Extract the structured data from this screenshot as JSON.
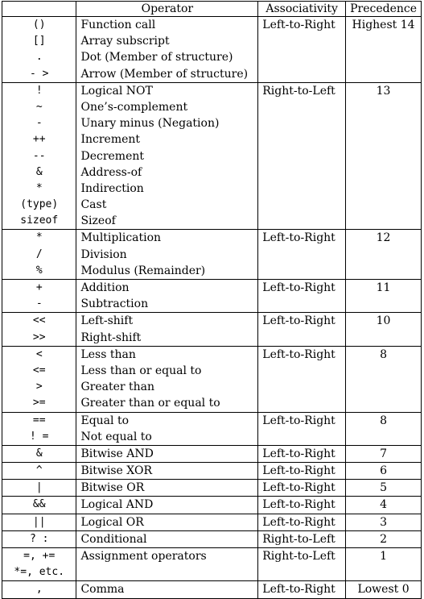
{
  "headers": [
    "",
    "Operator",
    "Associativity",
    "Precedence"
  ],
  "groups": [
    {
      "ops": [
        "()",
        "[]",
        ".",
        "- >"
      ],
      "descs": [
        "Function call",
        "Array subscript",
        "Dot (Member of structure)",
        "Arrow (Member of structure)"
      ],
      "assoc": "Left-to-Right",
      "prec": "Highest 14"
    },
    {
      "ops": [
        "!",
        "~",
        "-",
        "++",
        "--",
        "&",
        "*",
        "(type)",
        "sizeof"
      ],
      "descs": [
        "Logical NOT",
        "One’s-complement",
        "Unary minus (Negation)",
        "Increment",
        "Decrement",
        "Address-of",
        "Indirection",
        "Cast",
        "Sizeof"
      ],
      "assoc": "Right-to-Left",
      "prec": "13"
    },
    {
      "ops": [
        "*",
        "/",
        "%"
      ],
      "descs": [
        "Multiplication",
        "Division",
        "Modulus (Remainder)"
      ],
      "assoc": "Left-to-Right",
      "prec": "12"
    },
    {
      "ops": [
        "+",
        "-"
      ],
      "descs": [
        "Addition",
        "Subtraction"
      ],
      "assoc": "Left-to-Right",
      "prec": "11"
    },
    {
      "ops": [
        "<<",
        ">>"
      ],
      "descs": [
        "Left-shift",
        "Right-shift"
      ],
      "assoc": "Left-to-Right",
      "prec": "10"
    },
    {
      "ops": [
        "<",
        "<=",
        ">",
        ">="
      ],
      "descs": [
        "Less than",
        "Less than or equal to",
        "Greater than",
        "Greater than or equal to"
      ],
      "assoc": "Left-to-Right",
      "prec": "8"
    },
    {
      "ops": [
        "==",
        "! ="
      ],
      "descs": [
        "Equal to",
        "Not equal to"
      ],
      "assoc": "Left-to-Right",
      "prec": "8"
    },
    {
      "ops": [
        "&"
      ],
      "descs": [
        "Bitwise AND"
      ],
      "assoc": "Left-to-Right",
      "prec": "7"
    },
    {
      "ops": [
        "^"
      ],
      "descs": [
        "Bitwise XOR"
      ],
      "assoc": "Left-to-Right",
      "prec": "6"
    },
    {
      "ops": [
        "|"
      ],
      "descs": [
        "Bitwise OR"
      ],
      "assoc": "Left-to-Right",
      "prec": "5"
    },
    {
      "ops": [
        "&&"
      ],
      "descs": [
        "Logical AND"
      ],
      "assoc": "Left-to-Right",
      "prec": "4"
    },
    {
      "ops": [
        "||"
      ],
      "descs": [
        "Logical OR"
      ],
      "assoc": "Left-to-Right",
      "prec": "3"
    },
    {
      "ops": [
        "?  :"
      ],
      "descs": [
        "Conditional"
      ],
      "assoc": "Right-to-Left",
      "prec": "2"
    },
    {
      "ops": [
        "=, +=",
        "*=, etc."
      ],
      "descs": [
        "Assignment operators"
      ],
      "assoc": "Right-to-Left",
      "prec": "1"
    },
    {
      "ops": [
        ","
      ],
      "descs": [
        "Comma"
      ],
      "assoc": "Left-to-Right",
      "prec": "Lowest 0"
    }
  ]
}
